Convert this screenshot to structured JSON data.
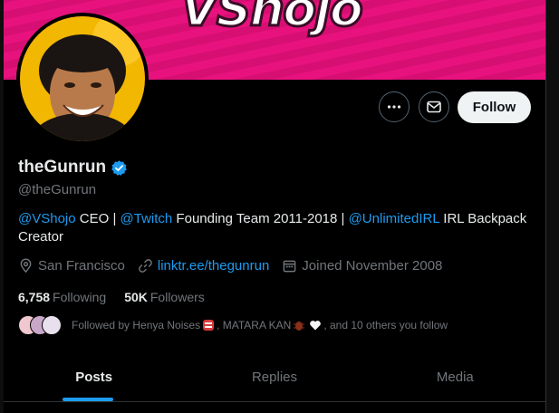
{
  "banner": {
    "logo_text": "VShojo",
    "color": "#e8127e"
  },
  "profile": {
    "display_name": "theGunrun",
    "handle": "@theGunrun",
    "verified": true
  },
  "actions": {
    "more_icon": "more-horizontal-icon",
    "message_icon": "envelope-icon",
    "follow_label": "Follow"
  },
  "bio": {
    "mention1": "@VShojo",
    "text1": " CEO | ",
    "mention2": "@Twitch",
    "text2": " Founding Team 2011-2018  | ",
    "mention3": "@UnlimitedIRL",
    "text3": " IRL Backpack Creator"
  },
  "meta": {
    "location": "San Francisco",
    "website": "linktr.ee/thegunrun",
    "joined": "Joined November 2008"
  },
  "counts": {
    "following_num": "6,758",
    "following_label": "Following",
    "followers_num": "50K",
    "followers_label": "Followers"
  },
  "followed_by": {
    "prefix": "Followed by Henya Noises",
    "middle": ", MATARA KAN",
    "suffix": ", and 10 others you follow"
  },
  "tabs": [
    {
      "label": "Posts",
      "active": true
    },
    {
      "label": "Replies",
      "active": false
    },
    {
      "label": "Media",
      "active": false
    }
  ],
  "colors": {
    "accent": "#1d9bf0",
    "background": "#000000"
  }
}
